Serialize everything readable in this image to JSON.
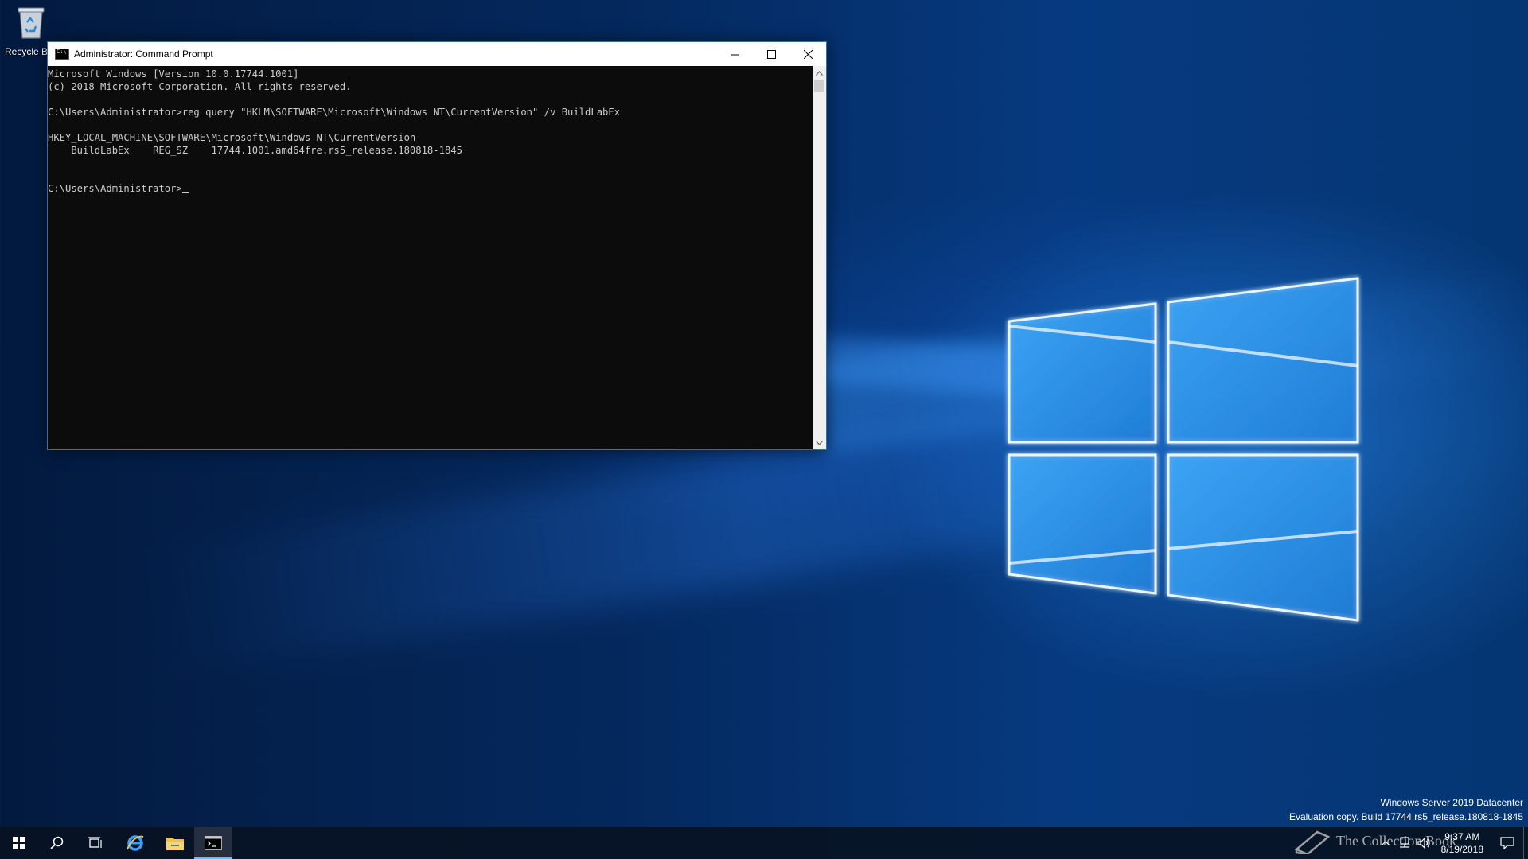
{
  "desktop": {
    "recycle_bin_label": "Recycle B"
  },
  "window": {
    "title": "Administrator: Command Prompt",
    "console_lines": [
      "Microsoft Windows [Version 10.0.17744.1001]",
      "(c) 2018 Microsoft Corporation. All rights reserved.",
      "",
      "C:\\Users\\Administrator>reg query \"HKLM\\SOFTWARE\\Microsoft\\Windows NT\\CurrentVersion\" /v BuildLabEx",
      "",
      "HKEY_LOCAL_MACHINE\\SOFTWARE\\Microsoft\\Windows NT\\CurrentVersion",
      "    BuildLabEx    REG_SZ    17744.1001.amd64fre.rs5_release.180818-1845",
      "",
      "",
      "C:\\Users\\Administrator>"
    ]
  },
  "watermark": {
    "edition": "Windows Server 2019 Datacenter",
    "build": "Evaluation copy. Build 17744.rs5_release.180818-1845"
  },
  "taskbar": {
    "icons": [
      "windows-start-icon",
      "search-icon",
      "task-view-icon",
      "internet-explorer-icon",
      "file-explorer-icon",
      "command-prompt-icon"
    ],
    "time": "9:37 AM",
    "date": "8/19/2018",
    "overlay_text": "The Collection Book"
  },
  "colors": {
    "console_bg": "#0c0c0c",
    "console_fg": "#cccccc",
    "accent": "#76b9ed"
  }
}
